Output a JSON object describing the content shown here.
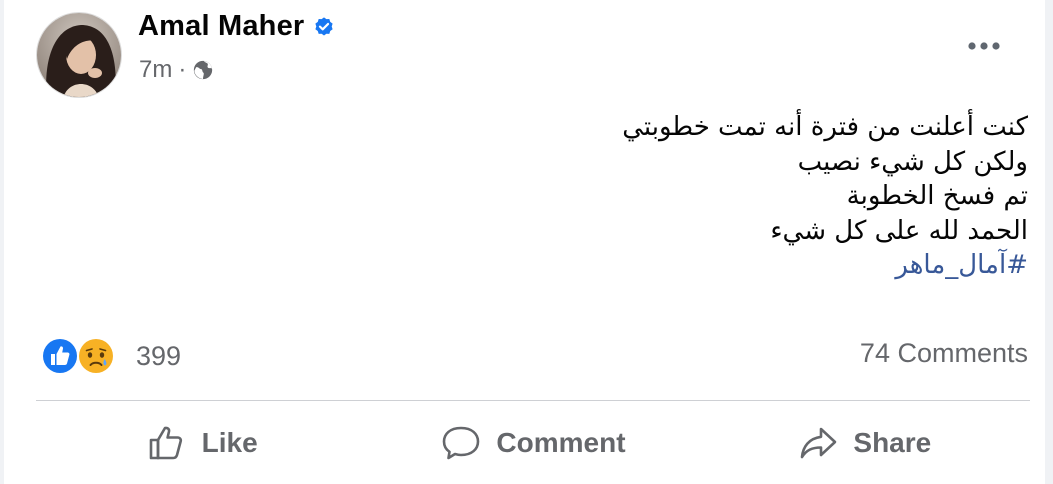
{
  "post": {
    "author": "Amal Maher",
    "time": "7m",
    "separator": "·",
    "privacy_icon": "globe-icon",
    "verified_icon": "verified-badge-icon",
    "more_icon": "more-options-icon",
    "text_lines": [
      "كنت أعلنت من فترة أنه تمت خطوبتي",
      "ولكن كل شيء نصيب",
      "تم فسخ الخطوبة",
      "الحمد لله على كل شيء"
    ],
    "hashtag": "#آمال_ماهر"
  },
  "stats": {
    "reaction_icons": [
      "like-reaction-icon",
      "sad-reaction-icon"
    ],
    "reaction_count": "399",
    "comments": "74 Comments"
  },
  "actions": {
    "like": "Like",
    "comment": "Comment",
    "share": "Share"
  },
  "colors": {
    "link": "#385898",
    "secondary_text": "#65676b",
    "verified": "#1877f2",
    "like_blue": "#1877f2",
    "sad_yellow": "#f7b125",
    "divider": "#ced0d4"
  }
}
